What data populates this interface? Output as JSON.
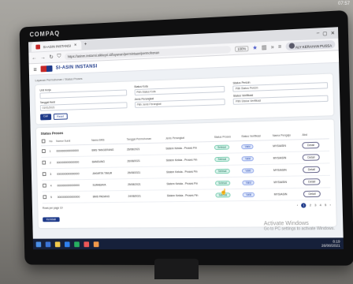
{
  "photo_overlay": {
    "time": "07:57"
  },
  "monitor": {
    "brand": "COMPAQ"
  },
  "browser": {
    "tab_title": "SI-ASIN INSTANSI",
    "url": "https://asinm.instansi.sikkeyri.id/layanan/permintaan/permohonan",
    "zoom": "100%",
    "profile_label": "ALY KERAHAN PUSSA"
  },
  "app": {
    "title": "SI-ASIN INSTANSI",
    "breadcrumb": "Layanan Permohonan / Status Proses",
    "filters": [
      {
        "label": "Unit Kerja",
        "value": ""
      },
      {
        "label": "Status Kota",
        "value": "Pilih Status Kota"
      },
      {
        "label": "Status Perizin",
        "value": "Pilih Status Perizin"
      },
      {
        "label": "Tanggal Awal",
        "value": "01/01/2021"
      },
      {
        "label": "Jenis Perangkat",
        "value": "Pilih Jenis Perangkat"
      },
      {
        "label": "Status Verifikasi",
        "value": "Pilih Status Verifikasi"
      }
    ],
    "buttons": {
      "search": "Cari",
      "reset": "Reset"
    },
    "table": {
      "title": "Status Proses",
      "columns": [
        "No",
        "Nomor Surat",
        "Nama BMS",
        "Tanggal Permohonan",
        "Jenis Perangkat",
        "Status Proses",
        "Status Verifikasi",
        "Nama Pengaju",
        "Aksi"
      ],
      "rows": [
        {
          "no": "1",
          "nomor": "0000000000000000",
          "nama": "BMS TANGERANG",
          "tanggal": "26/08/2021",
          "jenis": "Sistem Kelola - Proses Fin",
          "status": "Selesai",
          "verif": "Valid",
          "user": "MYSIASIN",
          "aksi": "Detail"
        },
        {
          "no": "2",
          "nomor": "0000000000000000",
          "nama": "BANDUNG",
          "tanggal": "26/08/2021",
          "jenis": "Sistem Kelola - Proses Fin",
          "status": "Selesai",
          "verif": "Valid",
          "user": "MYSIASIN",
          "aksi": "Detail"
        },
        {
          "no": "3",
          "nomor": "0000000000000000",
          "nama": "JAKARTA TIMUR",
          "tanggal": "25/08/2021",
          "jenis": "Sistem Kelola - Proses Fin",
          "status": "Selesai",
          "verif": "Valid",
          "user": "MYSIASIN",
          "aksi": "Detail"
        },
        {
          "no": "4",
          "nomor": "0000000000000000",
          "nama": "SURABAYA",
          "tanggal": "25/08/2021",
          "jenis": "Sistem Kelola - Proses Fin",
          "status": "Selesai",
          "verif": "Valid",
          "user": "MYSIASIN",
          "aksi": "Detail"
        },
        {
          "no": "5",
          "nomor": "0000000000000000",
          "nama": "BMS PADANG",
          "tanggal": "24/08/2021",
          "jenis": "Sistem Kelola - Proses Fin",
          "status": "Selesai",
          "verif": "Valid",
          "user": "MYSIASIN",
          "aksi": "Detail"
        }
      ],
      "rows_per_page_label": "Rows per page",
      "rows_per_page": "10",
      "pages": [
        "1",
        "2",
        "3",
        "4",
        "5"
      ],
      "current_page": "1",
      "back_button": "Kembali"
    }
  },
  "windows": {
    "activate_title": "Activate Windows",
    "activate_sub": "Go to PC settings to activate Windows.",
    "time": "8:19",
    "date": "26/08/2021"
  },
  "colors": {
    "primary": "#1e3a8a",
    "accent": "#c62828",
    "taskbar": "#16203a"
  }
}
